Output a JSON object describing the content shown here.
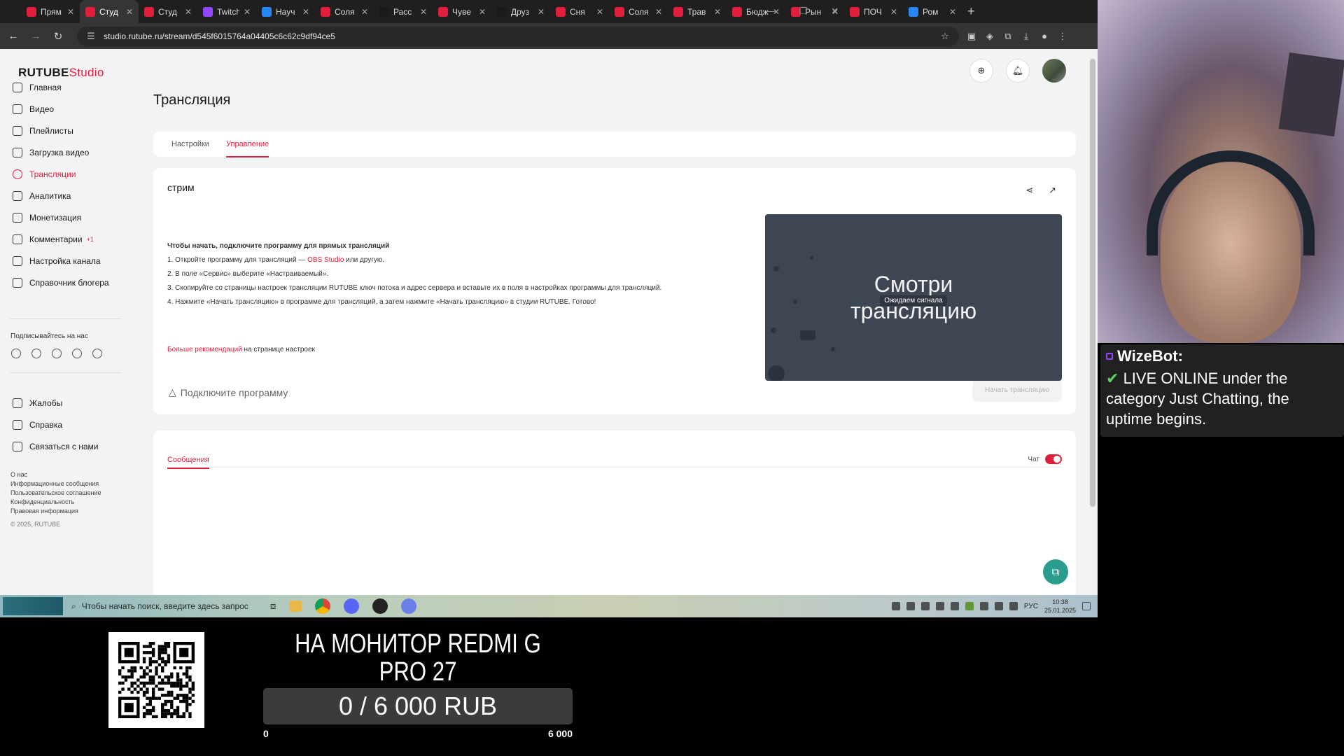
{
  "browser": {
    "tabs": [
      {
        "label": "Прям",
        "color": "#e01f3d",
        "active": false
      },
      {
        "label": "Студ",
        "color": "#e01f3d",
        "active": true
      },
      {
        "label": "Студ",
        "color": "#e01f3d",
        "active": false
      },
      {
        "label": "Twitch",
        "color": "#9146ff",
        "active": false
      },
      {
        "label": "Науч",
        "color": "#2787f5",
        "active": false
      },
      {
        "label": "Соля",
        "color": "#e01f3d",
        "active": false
      },
      {
        "label": "Расс",
        "color": "#1a1a1a",
        "active": false
      },
      {
        "label": "Чуве",
        "color": "#e01f3d",
        "active": false
      },
      {
        "label": "Друз",
        "color": "#1a1a1a",
        "active": false
      },
      {
        "label": "Сня",
        "color": "#e01f3d",
        "active": false
      },
      {
        "label": "Соля",
        "color": "#e01f3d",
        "active": false
      },
      {
        "label": "Трав",
        "color": "#e01f3d",
        "active": false
      },
      {
        "label": "Бюдж",
        "color": "#e01f3d",
        "active": false
      },
      {
        "label": "Рын",
        "color": "#e01f3d",
        "active": false
      },
      {
        "label": "ПОЧ",
        "color": "#e01f3d",
        "active": false
      },
      {
        "label": "Ром",
        "color": "#2787f5",
        "active": false
      }
    ],
    "url": "studio.rutube.ru/stream/d545f6015764a04405c6c62c9df94ce5"
  },
  "sidebar": {
    "logo_main": "RUTUBE",
    "logo_studio": "Studio",
    "items": [
      {
        "label": "Главная",
        "badge": ""
      },
      {
        "label": "Видео",
        "badge": ""
      },
      {
        "label": "Плейлисты",
        "badge": ""
      },
      {
        "label": "Загрузка видео",
        "badge": ""
      },
      {
        "label": "Трансляции",
        "badge": "",
        "active": true
      },
      {
        "label": "Аналитика",
        "badge": ""
      },
      {
        "label": "Монетизация",
        "badge": ""
      },
      {
        "label": "Комментарии",
        "badge": "+1"
      },
      {
        "label": "Настройка канала",
        "badge": ""
      },
      {
        "label": "Справочник блогера",
        "badge": ""
      }
    ],
    "follow_label": "Подписывайтесь на нас",
    "socials": [
      "vk",
      "ok",
      "tg",
      "viber",
      "+"
    ],
    "bottom_items": [
      {
        "label": "Жалобы"
      },
      {
        "label": "Справка"
      },
      {
        "label": "Связаться с нами"
      }
    ],
    "footer_links": [
      "О нас",
      "Информационные сообщения",
      "Пользовательское соглашение",
      "Конфиденциальность",
      "Правовая информация"
    ],
    "copyright": "© 2025, RUTUBE"
  },
  "main": {
    "title": "Трансляция",
    "tabs": [
      {
        "label": "Настройки",
        "active": false
      },
      {
        "label": "Управление",
        "active": true
      }
    ],
    "stream_name": "стрим",
    "instructions_lead": "Чтобы начать, подключите программу для прямых трансляций",
    "step1_a": "1. Откройте программу для трансляций — ",
    "step1_link": "OBS Studio",
    "step1_b": " или другую.",
    "step2": "2. В поле «Сервис» выберите «Настраиваемый».",
    "step3": "3. Скопируйте со страницы настроек трансляции RUTUBE ключ потока и адрес сервера и вставьте их в поля в настройках программы для трансляций.",
    "step4": "4. Нажмите «Начать трансляцию» в программе для трансляций, а затем нажмите «Начать трансляцию» в студии RUTUBE. Готово!",
    "more_link": "Больше рекомендаций",
    "more_text": " на странице настроек",
    "connect_program": "Подключите программу",
    "start_button": "Начать трансляцию",
    "preview_line1": "Смотри",
    "preview_line2": "трансляцию",
    "preview_waiting": "Ожидаем сигнала",
    "messages_tab": "Сообщения",
    "chat_label": "Чат",
    "chat_enabled": true
  },
  "taskbar": {
    "search_placeholder": "Чтобы начать поиск, введите здесь запрос",
    "lang": "РУС",
    "time": "10:38",
    "date": "25.01.2025"
  },
  "overlay": {
    "bot_name": "WizeBot:",
    "bot_message": "LIVE ONLINE under the category Just Chatting, the uptime begins.",
    "goal_title": "НА МОНИТОР REDMI G PRO 27",
    "goal_text": "0 / 6 000 RUB",
    "goal_min": "0",
    "goal_max": "6 000",
    "goal_progress": 0.0,
    "accent": "#e01f3d"
  }
}
